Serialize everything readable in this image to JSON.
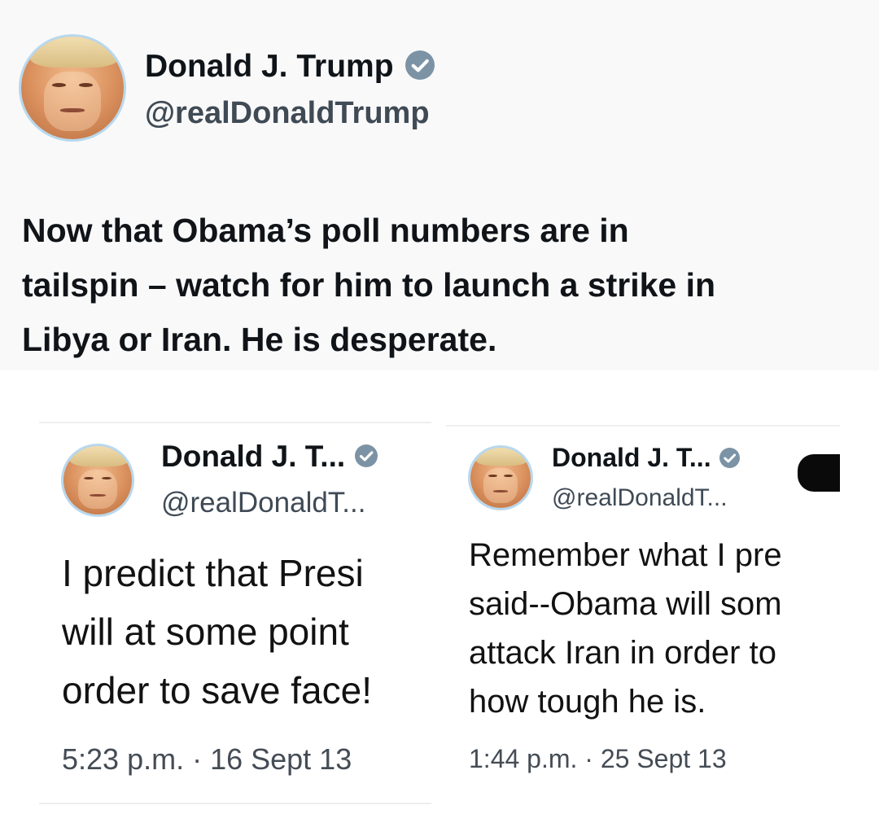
{
  "main_tweet": {
    "name": "Donald J. Trump",
    "handle": "@realDonaldTrump",
    "text": "Now that Obama’s poll numbers are in\ntailspin – watch for him to launch a strike in\nLibya or Iran.  He is desperate.",
    "verified_icon": "verified-badge-icon"
  },
  "left_tweet": {
    "name": "Donald J. T...",
    "handle": "@realDonaldT...",
    "text": "I predict that Presi\nwill at some point \norder to save face!",
    "time": "5:23 p.m. · 16 Sept 13"
  },
  "right_tweet": {
    "name": "Donald J. T...",
    "handle": "@realDonaldT...",
    "text": "Remember what I pre\nsaid--Obama will som\nattack Iran in order to\nhow tough he is.",
    "time": "1:44 p.m. · 25 Sept 13"
  },
  "colors": {
    "badge": "#7c93a6",
    "avatar_ring": "#b8d8ee",
    "text": "#0f1419",
    "follow_button": "#0a0a0a"
  }
}
